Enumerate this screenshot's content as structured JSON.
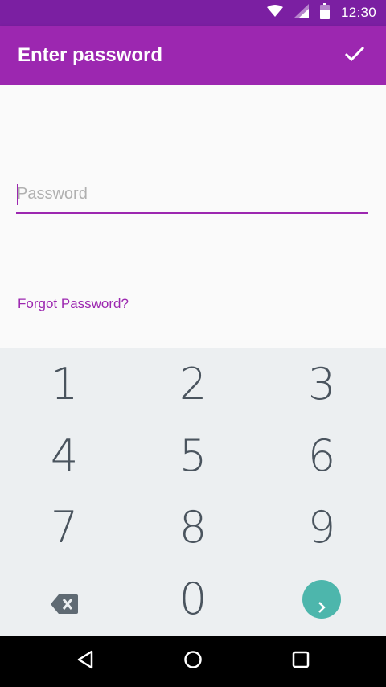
{
  "status_bar": {
    "time": "12:30",
    "icons": [
      "wifi-icon",
      "signal-icon",
      "battery-icon"
    ]
  },
  "app_bar": {
    "title": "Enter password",
    "action_icon": "check-icon"
  },
  "password_field": {
    "value": "",
    "placeholder": "Password"
  },
  "forgot_link": "Forgot Password?",
  "keypad": {
    "keys": [
      "1",
      "2",
      "3",
      "4",
      "5",
      "6",
      "7",
      "8",
      "9",
      "0"
    ],
    "delete_icon": "backspace-icon",
    "enter_icon": "chevron-right-icon"
  },
  "nav_bar": {
    "icons": [
      "back-icon",
      "home-icon",
      "recents-icon"
    ]
  },
  "colors": {
    "status_bar": "#7b1fa2",
    "app_bar": "#9c27b0",
    "accent": "#9c27b0",
    "keypad_bg": "#eceff1",
    "enter_button": "#4db6ac",
    "digit_text": "#4a545e"
  }
}
